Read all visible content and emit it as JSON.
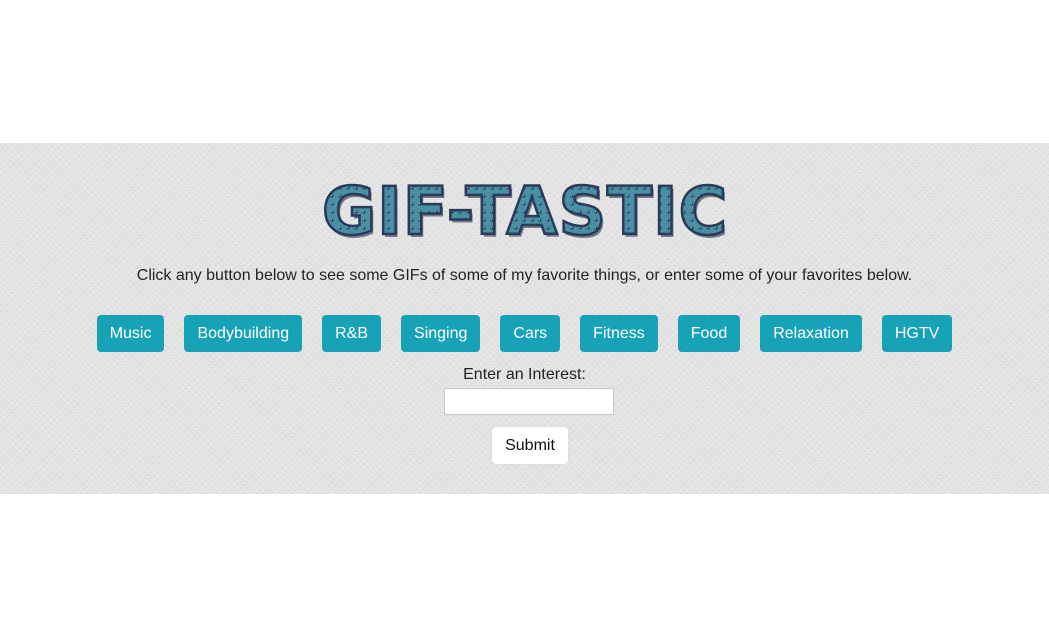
{
  "header": {
    "logo_text": "GIF-TASTIC",
    "intro_text": "Click any button below to see some GIFs of some of my favorite things, or enter some of your favorites below."
  },
  "topics": [
    {
      "label": "Music"
    },
    {
      "label": "Bodybuilding"
    },
    {
      "label": "R&B"
    },
    {
      "label": "Singing"
    },
    {
      "label": "Cars"
    },
    {
      "label": "Fitness"
    },
    {
      "label": "Food"
    },
    {
      "label": "Relaxation"
    },
    {
      "label": "HGTV"
    }
  ],
  "form": {
    "label": "Enter an Interest:",
    "input_value": "",
    "submit_label": "Submit"
  },
  "colors": {
    "button_teal": "#17a2b8",
    "logo_fill": "#4a8fa3",
    "logo_outline": "#2a3a5a",
    "banner_bg": "#e4e4e4"
  }
}
